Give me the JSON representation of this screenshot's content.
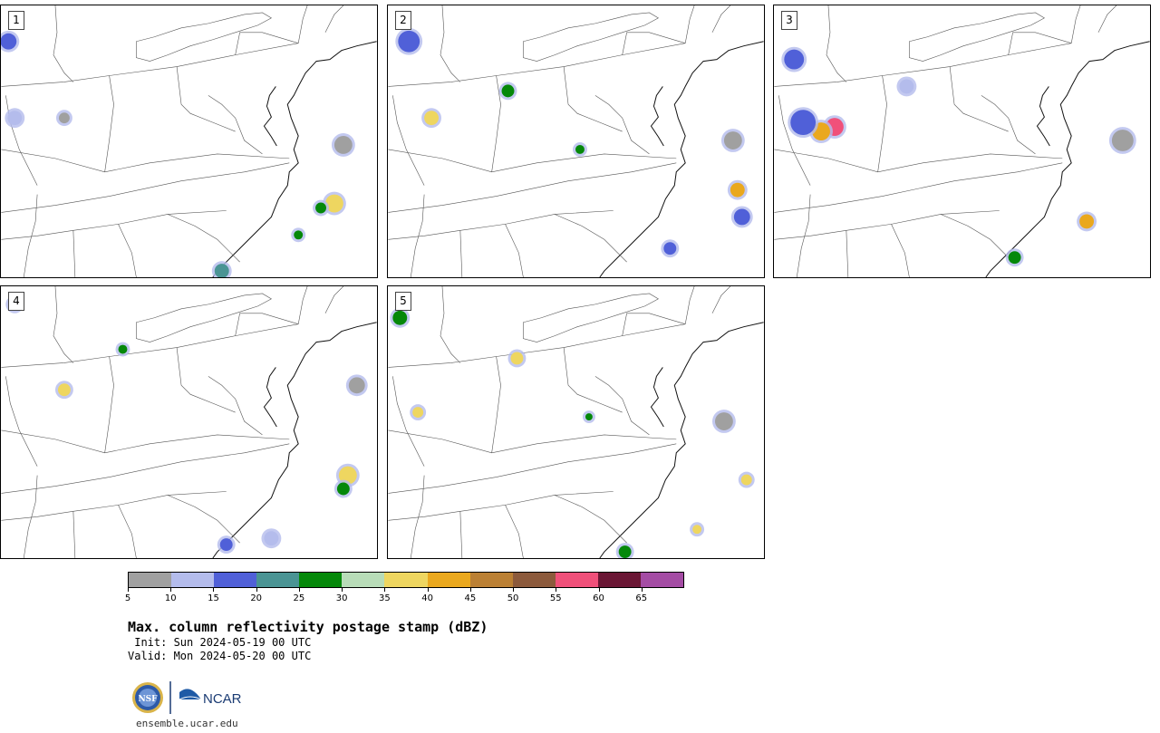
{
  "panels": [
    {
      "id": "p1",
      "label": "1"
    },
    {
      "id": "p2",
      "label": "2"
    },
    {
      "id": "p3",
      "label": "3"
    },
    {
      "id": "p4",
      "label": "4"
    },
    {
      "id": "p5",
      "label": "5"
    }
  ],
  "colorbar": {
    "colors": [
      "#a0a0a0",
      "#b4bcec",
      "#5060d8",
      "#4a9494",
      "#05880a",
      "#b8dcb8",
      "#eed660",
      "#eaa81e",
      "#bb8034",
      "#8c5a3c",
      "#f0507a",
      "#6a1634",
      "#a44ca4"
    ],
    "tick_labels": [
      "5",
      "10",
      "15",
      "20",
      "25",
      "30",
      "35",
      "40",
      "45",
      "50",
      "55",
      "60",
      "65"
    ]
  },
  "title": "Max. column reflectivity postage stamp (dBZ)",
  "init": " Init: Sun 2024-05-19 00 UTC",
  "valid": "Valid: Mon 2024-05-20 00 UTC",
  "logos": {
    "nsf": "NSF",
    "ncar": "NCAR"
  },
  "website": "ensemble.ucar.edu"
}
